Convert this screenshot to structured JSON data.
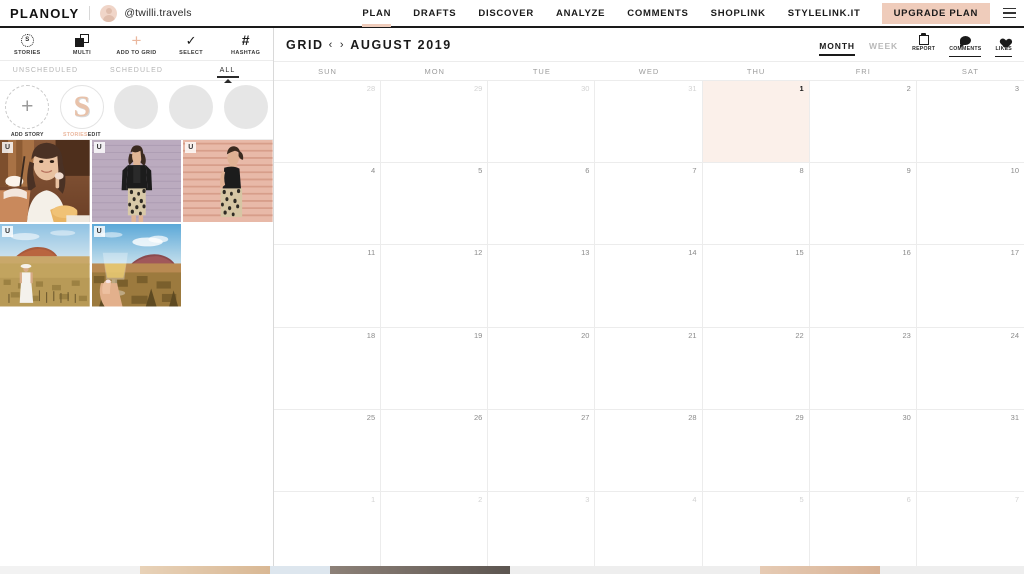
{
  "app": {
    "brand": "PLANOLY",
    "account_handle": "@twilli.travels",
    "accent_color": "#efccbb"
  },
  "topnav": {
    "items": [
      {
        "label": "PLAN",
        "active": true
      },
      {
        "label": "DRAFTS",
        "active": false
      },
      {
        "label": "DISCOVER",
        "active": false
      },
      {
        "label": "ANALYZE",
        "active": false
      },
      {
        "label": "COMMENTS",
        "active": false
      },
      {
        "label": "SHOPLINK",
        "active": false
      },
      {
        "label": "STYLELINK.IT",
        "active": false
      }
    ],
    "upgrade_label": "UPGRADE PLAN",
    "menu_icon": "hamburger-icon"
  },
  "sidebar": {
    "tools": [
      {
        "label": "STORIES",
        "icon": "stories-icon"
      },
      {
        "label": "MULTI",
        "icon": "multi-select-icon"
      },
      {
        "label": "ADD TO GRID",
        "icon": "plus-icon"
      },
      {
        "label": "SELECT",
        "icon": "check-icon"
      },
      {
        "label": "HASHTAG",
        "icon": "hashtag-icon"
      }
    ],
    "filters": [
      {
        "label": "UNSCHEDULED",
        "active": false
      },
      {
        "label": "SCHEDULED",
        "active": false
      },
      {
        "label": "ALL",
        "active": true
      }
    ],
    "stories": [
      {
        "label": "ADD STORY",
        "type": "add",
        "glyph": "+"
      },
      {
        "label_prefix": "STORIES",
        "label": "STORIESEDIT",
        "label_suffix": "EDIT",
        "type": "edit",
        "glyph": "S"
      },
      {
        "label": "",
        "type": "blank"
      },
      {
        "label": "",
        "type": "blank"
      },
      {
        "label": "",
        "type": "blank"
      }
    ],
    "photos": [
      {
        "badge": "U",
        "alt": "woman-with-milkshake-cafe",
        "empty": false
      },
      {
        "badge": "U",
        "alt": "woman-leather-jacket-lavender-wall",
        "empty": false
      },
      {
        "badge": "U",
        "alt": "woman-side-profile-pink-stripes",
        "empty": false
      },
      {
        "badge": "U",
        "alt": "woman-white-dress-desert-uluru",
        "empty": false
      },
      {
        "badge": "U",
        "alt": "hand-champagne-glass-uluru-sunset",
        "empty": false
      },
      {
        "badge": "",
        "alt": "",
        "empty": true
      }
    ]
  },
  "calendar": {
    "mode_label": "GRID",
    "prev_arrow": "‹",
    "next_arrow": "›",
    "month_title": "AUGUST 2019",
    "view_tabs": [
      {
        "label": "MONTH",
        "active": true
      },
      {
        "label": "WEEK",
        "active": false
      }
    ],
    "actions": [
      {
        "label": "REPORT",
        "icon": "report-icon",
        "underlined": false
      },
      {
        "label": "COMMENTS",
        "icon": "comment-bubble-icon",
        "underlined": true
      },
      {
        "label": "LIKES",
        "icon": "heart-icon",
        "underlined": true
      }
    ],
    "day_names": [
      "SUN",
      "MON",
      "TUE",
      "WED",
      "THU",
      "FRI",
      "SAT"
    ],
    "weeks": [
      [
        {
          "n": "28",
          "other": true,
          "today": false
        },
        {
          "n": "29",
          "other": true,
          "today": false
        },
        {
          "n": "30",
          "other": true,
          "today": false
        },
        {
          "n": "31",
          "other": true,
          "today": false
        },
        {
          "n": "1",
          "other": false,
          "today": true
        },
        {
          "n": "2",
          "other": false,
          "today": false
        },
        {
          "n": "3",
          "other": false,
          "today": false
        }
      ],
      [
        {
          "n": "4",
          "other": false,
          "today": false
        },
        {
          "n": "5",
          "other": false,
          "today": false
        },
        {
          "n": "6",
          "other": false,
          "today": false
        },
        {
          "n": "7",
          "other": false,
          "today": false
        },
        {
          "n": "8",
          "other": false,
          "today": false
        },
        {
          "n": "9",
          "other": false,
          "today": false
        },
        {
          "n": "10",
          "other": false,
          "today": false
        }
      ],
      [
        {
          "n": "11",
          "other": false,
          "today": false
        },
        {
          "n": "12",
          "other": false,
          "today": false
        },
        {
          "n": "13",
          "other": false,
          "today": false
        },
        {
          "n": "14",
          "other": false,
          "today": false
        },
        {
          "n": "15",
          "other": false,
          "today": false
        },
        {
          "n": "16",
          "other": false,
          "today": false
        },
        {
          "n": "17",
          "other": false,
          "today": false
        }
      ],
      [
        {
          "n": "18",
          "other": false,
          "today": false
        },
        {
          "n": "19",
          "other": false,
          "today": false
        },
        {
          "n": "20",
          "other": false,
          "today": false
        },
        {
          "n": "21",
          "other": false,
          "today": false
        },
        {
          "n": "22",
          "other": false,
          "today": false
        },
        {
          "n": "23",
          "other": false,
          "today": false
        },
        {
          "n": "24",
          "other": false,
          "today": false
        }
      ],
      [
        {
          "n": "25",
          "other": false,
          "today": false
        },
        {
          "n": "26",
          "other": false,
          "today": false
        },
        {
          "n": "27",
          "other": false,
          "today": false
        },
        {
          "n": "28",
          "other": false,
          "today": false
        },
        {
          "n": "29",
          "other": false,
          "today": false
        },
        {
          "n": "30",
          "other": false,
          "today": false
        },
        {
          "n": "31",
          "other": false,
          "today": false
        }
      ],
      [
        {
          "n": "1",
          "other": true,
          "today": false
        },
        {
          "n": "2",
          "other": true,
          "today": false
        },
        {
          "n": "3",
          "other": true,
          "today": false
        },
        {
          "n": "4",
          "other": true,
          "today": false
        },
        {
          "n": "5",
          "other": true,
          "today": false
        },
        {
          "n": "6",
          "other": true,
          "today": false
        },
        {
          "n": "7",
          "other": true,
          "today": false
        }
      ]
    ]
  }
}
